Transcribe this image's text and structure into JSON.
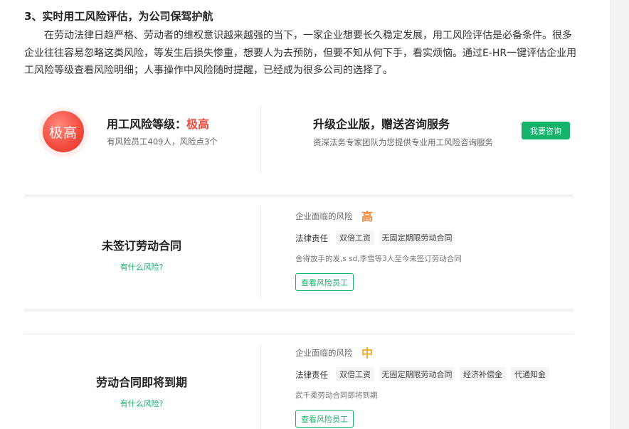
{
  "article": {
    "heading": "3、实时用工风险评估，为公司保驾护航",
    "paragraph": "在劳动法律日趋严格、劳动者的维权意识越来越强的当下，一家企业想要长久稳定发展，用工风险评估是必备条件。很多企业往往容易忽略这类风险，等发生后损失惨重，想要人为去预防，但要不知从何下手，看实烦恼。通过E-HR一键评估企业用工风险等级查看风险明细；人事操作中风险随时提醒，已经成为很多公司的选择了。"
  },
  "summary": {
    "badge_text": "极高",
    "level_label": "用工风险等级：",
    "level_value": "极高",
    "level_sub": "有风险员工409人，风险点3个",
    "promo_title": "升级企业版，赠送咨询服务",
    "promo_sub": "资深法务专家团队为您提供专业用工风险咨询服务",
    "consult_button": "我要咨询"
  },
  "risk_cards": [
    {
      "title": "未签订劳动合同",
      "link": "有什么风险?",
      "face_label": "企业面临的风险",
      "face_level": "高",
      "law_label": "法律责任",
      "chips": [
        "双倍工资",
        "无固定期限劳动合同"
      ],
      "note": "舍得放手的发,s sd,李雪等3人至今未签订劳动合同",
      "button": "查看风险员工"
    },
    {
      "title": "劳动合同即将到期",
      "link": "有什么风险?",
      "face_label": "企业面临的风险",
      "face_level": "中",
      "law_label": "法律责任",
      "chips": [
        "双倍工资",
        "无固定期限劳动合同",
        "经济补偿金",
        "代通知金"
      ],
      "note": "武千柔劳动合同即将到期",
      "button": "查看风险员工"
    }
  ],
  "colors": {
    "brand_green": "#14b36b",
    "risk_extreme": "#f04a3a",
    "risk_high": "#f5873a",
    "risk_medium": "#f6a823"
  }
}
